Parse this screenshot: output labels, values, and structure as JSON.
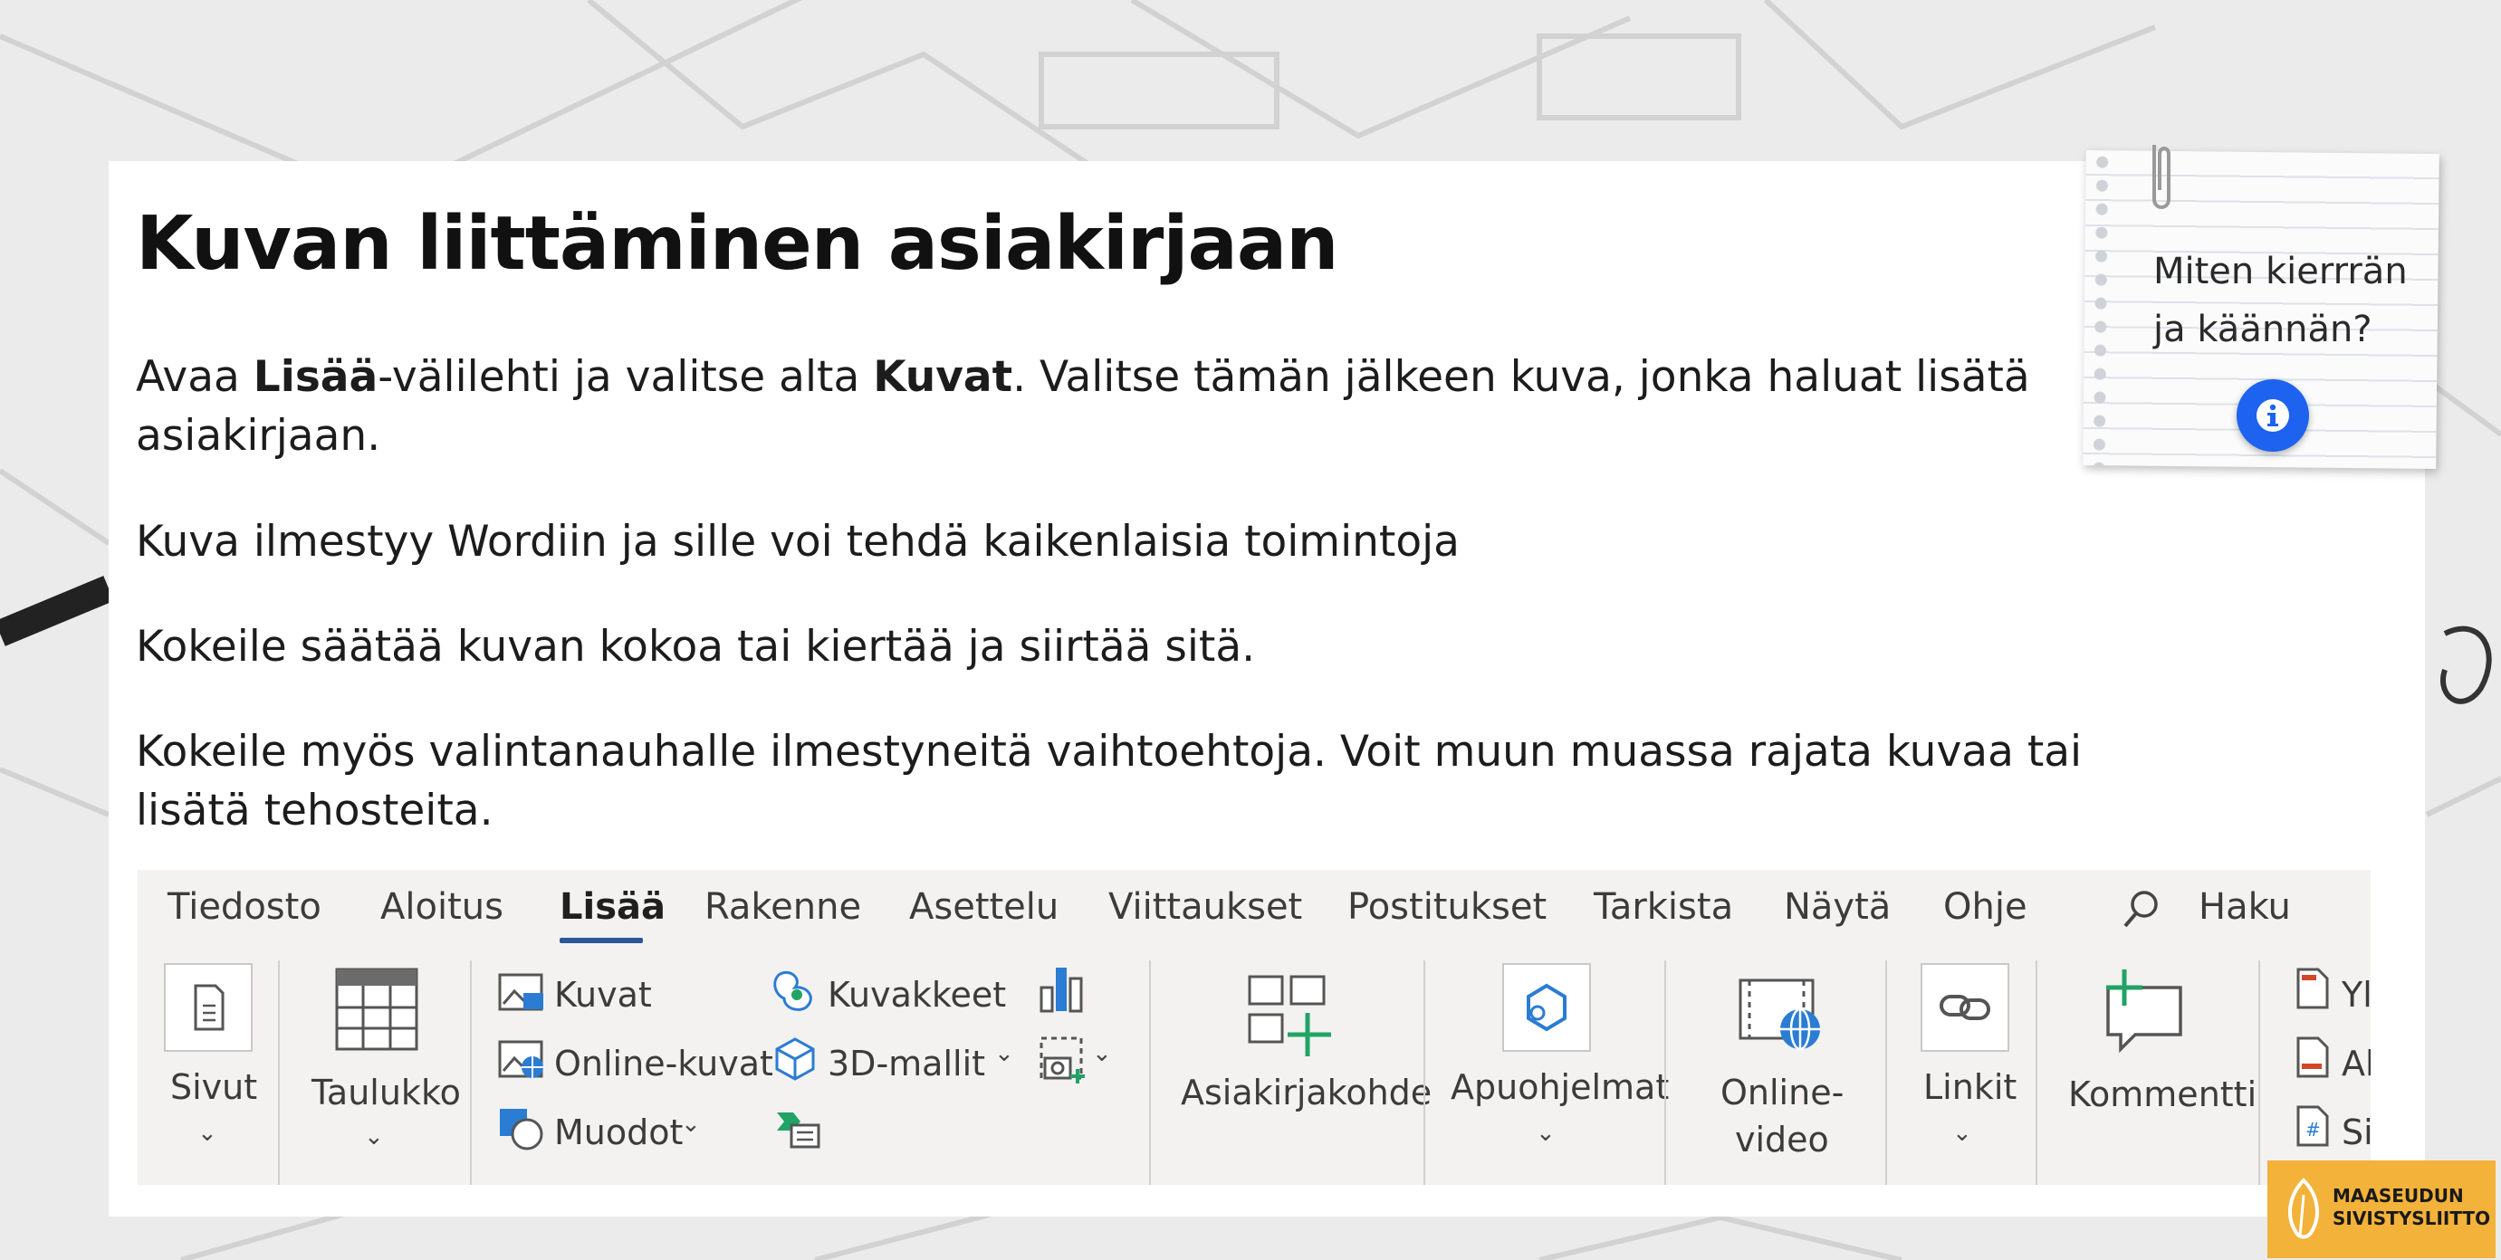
{
  "page": {
    "title": "Kuvan liittäminen asiakirjaan",
    "paragraph1": {
      "t1": "Avaa ",
      "b1": "Lisää",
      "t2": "-välilehti ja valitse alta ",
      "b2": "Kuvat",
      "t3": ". Valitse tämän jälkeen kuva, jonka haluat lisätä asiakirjaan."
    },
    "paragraph2": "Kuva ilmestyy Wordiin ja sille voi tehdä kaikenlaisia toimintoja",
    "paragraph3": "Kokeile säätää kuvan kokoa tai kiertää ja siirtää sitä.",
    "paragraph4": "Kokeile myös valintanauhalle ilmestyneitä vaihtoehtoja. Voit muun muassa rajata kuvaa tai lisätä tehosteita."
  },
  "note": {
    "line1": "Miten kierrrän",
    "line2": "ja käännän?",
    "icon": "info-icon"
  },
  "ribbon": {
    "tabs": [
      {
        "label": "Tiedosto"
      },
      {
        "label": "Aloitus"
      },
      {
        "label": "Lisää"
      },
      {
        "label": "Rakenne"
      },
      {
        "label": "Asettelu"
      },
      {
        "label": "Viittaukset"
      },
      {
        "label": "Postitukset"
      },
      {
        "label": "Tarkista"
      },
      {
        "label": "Näytä"
      },
      {
        "label": "Ohje"
      }
    ],
    "active_tab": "Lisää",
    "search_label": "Haku",
    "groups": {
      "sivut": "Sivut",
      "taulukko": "Taulukko",
      "kuvat": "Kuvat",
      "online_kuvat": "Online-kuvat",
      "muodot": "Muodot",
      "kuvakkeet": "Kuvakkeet",
      "mallit_3d": "3D-mallit",
      "asiakirjakohde": "Asiakirjakohde",
      "apuohjelmat": "Apuohjelmat",
      "online_video_1": "Online-",
      "online_video_2": "video",
      "linkit": "Linkit",
      "kommentti": "Kommentti",
      "cut1": "Yl",
      "cut2": "Al",
      "cut3": "Si"
    },
    "colors": {
      "accent": "#2b579a",
      "icon_blue": "#2b7cd3",
      "icon_green": "#21a366"
    }
  },
  "logo": {
    "line1": "MAASEUDUN",
    "line2": "SIVISTYSLIITTO",
    "color": "#f3b23a"
  }
}
